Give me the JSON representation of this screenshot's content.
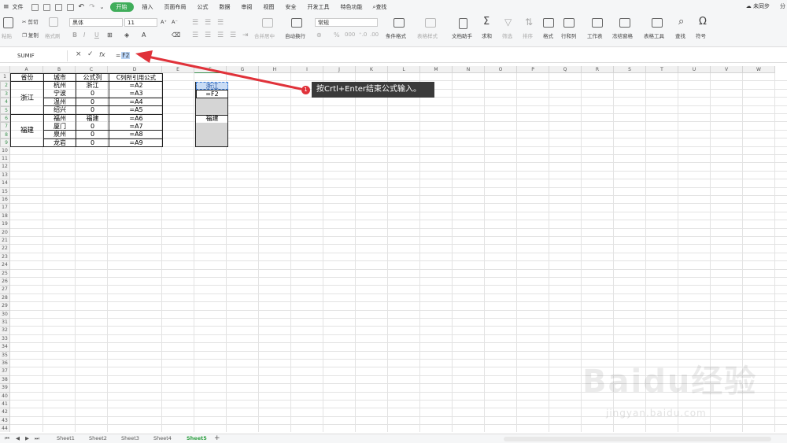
{
  "menubar": {
    "file": "文件",
    "tabs": [
      "开始",
      "插入",
      "页面布局",
      "公式",
      "数据",
      "审阅",
      "视图",
      "安全",
      "开发工具",
      "特色功能"
    ],
    "active_tab": "开始",
    "search": "查找",
    "sync": "未同步",
    "share": "分"
  },
  "ribbon": {
    "paste": "粘贴",
    "cut": "剪切",
    "copy": "复制",
    "format_painter": "格式刷",
    "font": "黑体",
    "size": "11",
    "merge": "合并居中",
    "wrap": "自动换行",
    "number_format": "常规",
    "cond_format": "条件格式",
    "table_style": "表格样式",
    "doc_helper": "文档助手",
    "sum": "求和",
    "filter": "筛选",
    "sort": "排序",
    "format": "格式",
    "row_col": "行和列",
    "worksheet": "工作表",
    "freeze": "冻结窗格",
    "table_tools": "表格工具",
    "find": "查找",
    "symbol": "符号"
  },
  "formula": {
    "name_box": "SUMIF",
    "cancel": "×",
    "confirm": "✓",
    "fx": "fx",
    "prefix": "=",
    "ref": "F2"
  },
  "columns": [
    "A",
    "B",
    "C",
    "D",
    "E",
    "F",
    "G",
    "H",
    "I",
    "J",
    "K",
    "L",
    "M",
    "N",
    "O",
    "P",
    "Q",
    "R",
    "S",
    "T",
    "U",
    "V",
    "W"
  ],
  "rows": [
    "1",
    "2",
    "3",
    "4",
    "5",
    "6",
    "7",
    "8",
    "9",
    "10",
    "11",
    "12",
    "13",
    "14",
    "15",
    "16",
    "17",
    "18",
    "19",
    "20",
    "21",
    "22",
    "23",
    "24",
    "25",
    "26",
    "27",
    "28",
    "29",
    "30",
    "31",
    "32",
    "33",
    "34",
    "35",
    "36",
    "37",
    "38",
    "39",
    "40",
    "41",
    "42",
    "43",
    "44"
  ],
  "table": {
    "headers": [
      "省份",
      "城市",
      "公式列",
      "C列所引用公式"
    ],
    "province_1": "浙江",
    "province_2": "福建",
    "rows": [
      {
        "city": "杭州",
        "val": "浙江",
        "ref": "=A2"
      },
      {
        "city": "宁波",
        "val": "0",
        "ref": "=A3"
      },
      {
        "city": "温州",
        "val": "0",
        "ref": "=A4"
      },
      {
        "city": "绍兴",
        "val": "0",
        "ref": "=A5"
      },
      {
        "city": "福州",
        "val": "福建",
        "ref": "=A6"
      },
      {
        "city": "厦门",
        "val": "0",
        "ref": "=A7"
      },
      {
        "city": "泉州",
        "val": "0",
        "ref": "=A8"
      },
      {
        "city": "龙岩",
        "val": "0",
        "ref": "=A9"
      }
    ]
  },
  "fcol": {
    "f2": "浙江",
    "f3": "=F2",
    "f6": "福建"
  },
  "sheets": [
    "Sheet1",
    "Sheet2",
    "Sheet3",
    "Sheet4",
    "Sheet5"
  ],
  "active_sheet": "Sheet5",
  "add_sheet": "+",
  "callout": {
    "number": "1",
    "text": "按Crtl+Enter结束公式输入。"
  },
  "watermark": {
    "brand": "Baidu经验",
    "url": "jingyan.baidu.com"
  },
  "colors": {
    "accent": "#3fad5a",
    "arrow": "#e0323a",
    "selection": "#b8d3f5"
  }
}
